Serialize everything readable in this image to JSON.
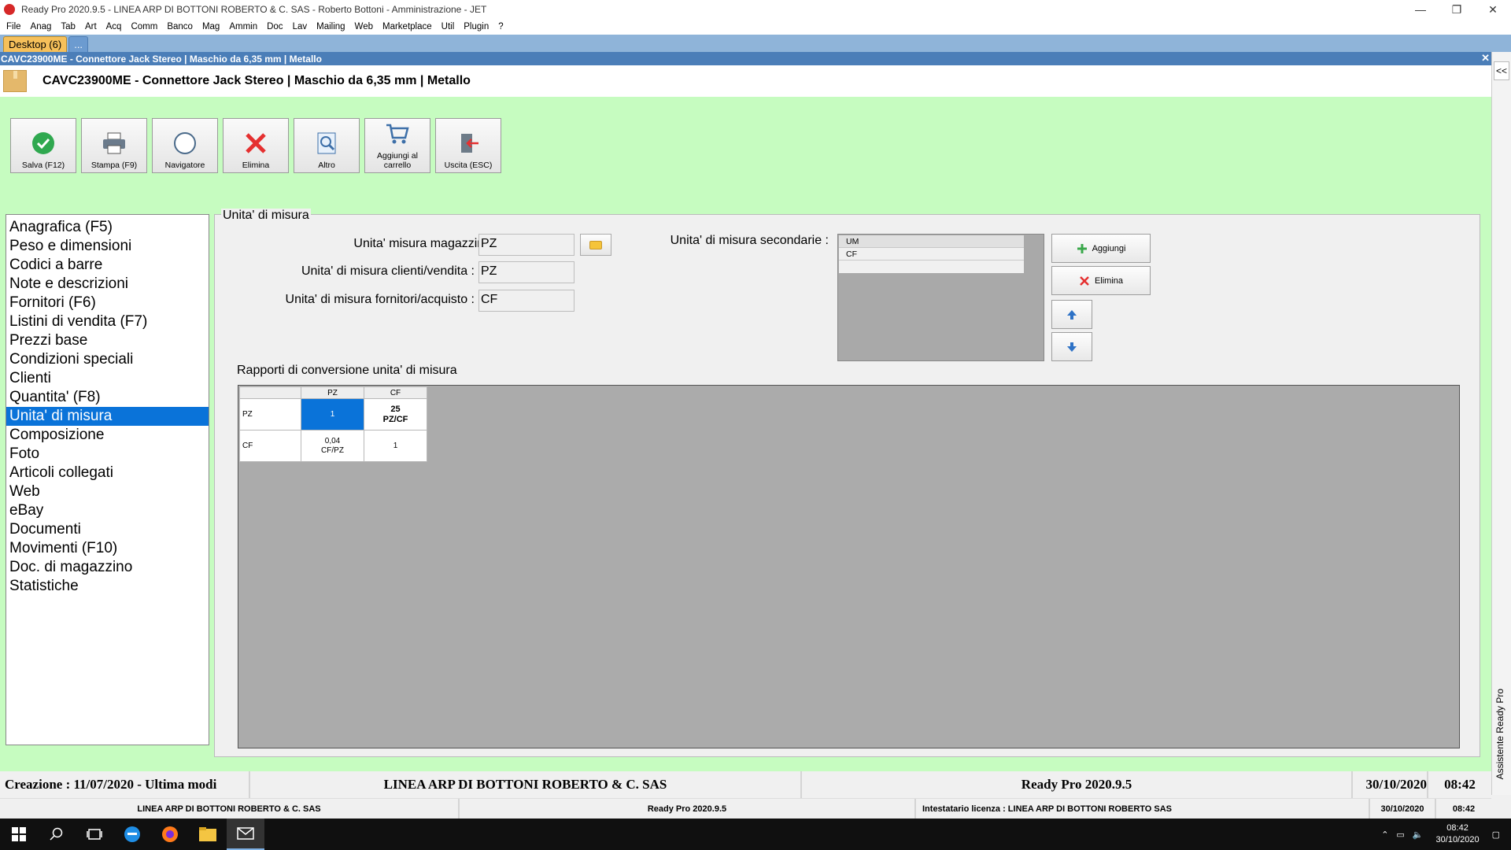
{
  "window": {
    "title": "Ready Pro 2020.9.5 - LINEA ARP DI BOTTONI ROBERTO & C. SAS - Roberto Bottoni - Amministrazione - JET",
    "minimize": "—",
    "restore": "❐",
    "close": "✕"
  },
  "menu": [
    "File",
    "Anag",
    "Tab",
    "Art",
    "Acq",
    "Comm",
    "Banco",
    "Mag",
    "Ammin",
    "Doc",
    "Lav",
    "Mailing",
    "Web",
    "Marketplace",
    "Util",
    "Plugin",
    "?"
  ],
  "desktop_tabs": {
    "active": "Desktop (6)",
    "more": "..."
  },
  "doc_caption": "CAVC23900ME - Connettore Jack Stereo | Maschio da 6,35 mm | Metallo",
  "doc_close": "✕",
  "doc_title": "CAVC23900ME - Connettore Jack Stereo | Maschio da 6,35 mm | Metallo",
  "toolbar": [
    {
      "label": "Salva (F12)",
      "icon": "check-circle-icon"
    },
    {
      "label": "Stampa (F9)",
      "icon": "printer-icon"
    },
    {
      "label": "Navigatore",
      "icon": "compass-icon"
    },
    {
      "label": "Elimina",
      "icon": "delete-x-icon"
    },
    {
      "label": "Altro",
      "icon": "search-document-icon"
    },
    {
      "label": "Aggiungi al carrello",
      "icon": "cart-icon"
    },
    {
      "label": "Uscita (ESC)",
      "icon": "exit-door-icon"
    }
  ],
  "nav": [
    "Anagrafica (F5)",
    "Peso e dimensioni",
    "Codici a barre",
    "Note e descrizioni",
    "Fornitori (F6)",
    "Listini di vendita (F7)",
    "Prezzi base",
    "Condizioni speciali",
    "Clienti",
    "Quantita' (F8)",
    "Unita' di misura",
    "Composizione",
    "Foto",
    "Articoli collegati",
    "Web",
    "eBay",
    "Documenti",
    "Movimenti (F10)",
    "Doc. di magazzino",
    "Statistiche"
  ],
  "nav_selected_index": 10,
  "um": {
    "group_title": "Unita' di misura",
    "magazzino_label": "Unita' misura magazzino :",
    "magazzino_value": "PZ",
    "vendita_label": "Unita' di misura clienti/vendita :",
    "vendita_value": "PZ",
    "acquisto_label": "Unita' di misura fornitori/acquisto :",
    "acquisto_value": "CF",
    "secondarie_label": "Unita' di misura secondarie :",
    "secondarie_header": "UM",
    "secondarie_rows": [
      "CF"
    ],
    "add_label": "Aggiungi",
    "delete_label": "Elimina",
    "conv_title": "Rapporti di conversione unita' di misura",
    "conv": {
      "cols": [
        "PZ",
        "CF"
      ],
      "rows": [
        {
          "label": "PZ",
          "cells": [
            {
              "value": "1",
              "unit": ""
            },
            {
              "value": "25",
              "unit": "PZ/CF"
            }
          ]
        },
        {
          "label": "CF",
          "cells": [
            {
              "value": "0,04",
              "unit": "CF/PZ"
            },
            {
              "value": "1",
              "unit": ""
            }
          ]
        }
      ]
    }
  },
  "status1": {
    "dates": "Creazione : 11/07/2020 - Ultima modi",
    "company": "LINEA ARP DI BOTTONI ROBERTO & C. SAS",
    "version": "Ready Pro 2020.9.5",
    "date": "30/10/2020",
    "time": "08:42"
  },
  "status2": {
    "company": "LINEA ARP DI BOTTONI ROBERTO & C. SAS",
    "version": "Ready Pro 2020.9.5",
    "license": "Intestatario licenza : LINEA ARP DI BOTTONI ROBERTO SAS",
    "date": "30/10/2020",
    "time": "08:42"
  },
  "side_panel": {
    "collapse": "<<",
    "assistant": "Assistente Ready Pro"
  },
  "taskbar": {
    "time": "08:42",
    "date": "30/10/2020"
  },
  "colors": {
    "green_bg": "#c6fcc0",
    "selection": "#0a73d9",
    "caption": "#4b7eb8"
  }
}
